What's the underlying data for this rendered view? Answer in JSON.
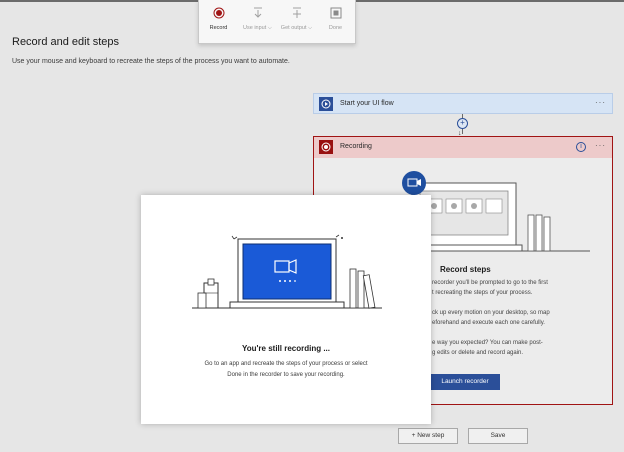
{
  "page": {
    "title": "Record and edit steps",
    "description": "Use your mouse and keyboard to recreate the steps of the process you want to automate."
  },
  "toolbar": {
    "record_label": "Record",
    "use_input_label": "Use input ⌵",
    "get_output_label": "Get output ⌵",
    "done_label": "Done"
  },
  "flow": {
    "start_label": "Start your UI flow",
    "recording_label": "Recording",
    "more": "···",
    "plus": "+",
    "arrow": "↓",
    "info": "i"
  },
  "recording_card": {
    "title": "Record steps",
    "lines": [
      "recorder you'll be prompted to go to the first",
      "t recreating the steps of your process.",
      "ck up every motion on your desktop, so map",
      "eforehand and execute each one carefully.",
      "e way you expected? You can make post-",
      "g edits or delete and record again."
    ],
    "launch_label": "Launch recorder"
  },
  "buttons": {
    "new_step": "+ New step",
    "save": "Save"
  },
  "modal": {
    "title": "You're still recording ...",
    "line1": "Go to an app and recreate the steps of your process or select",
    "line2": "Done in the recorder to save your recording."
  },
  "colors": {
    "accent": "#2b4f99",
    "record_red": "#a01414",
    "laptop_blue": "#1a5ad7"
  }
}
